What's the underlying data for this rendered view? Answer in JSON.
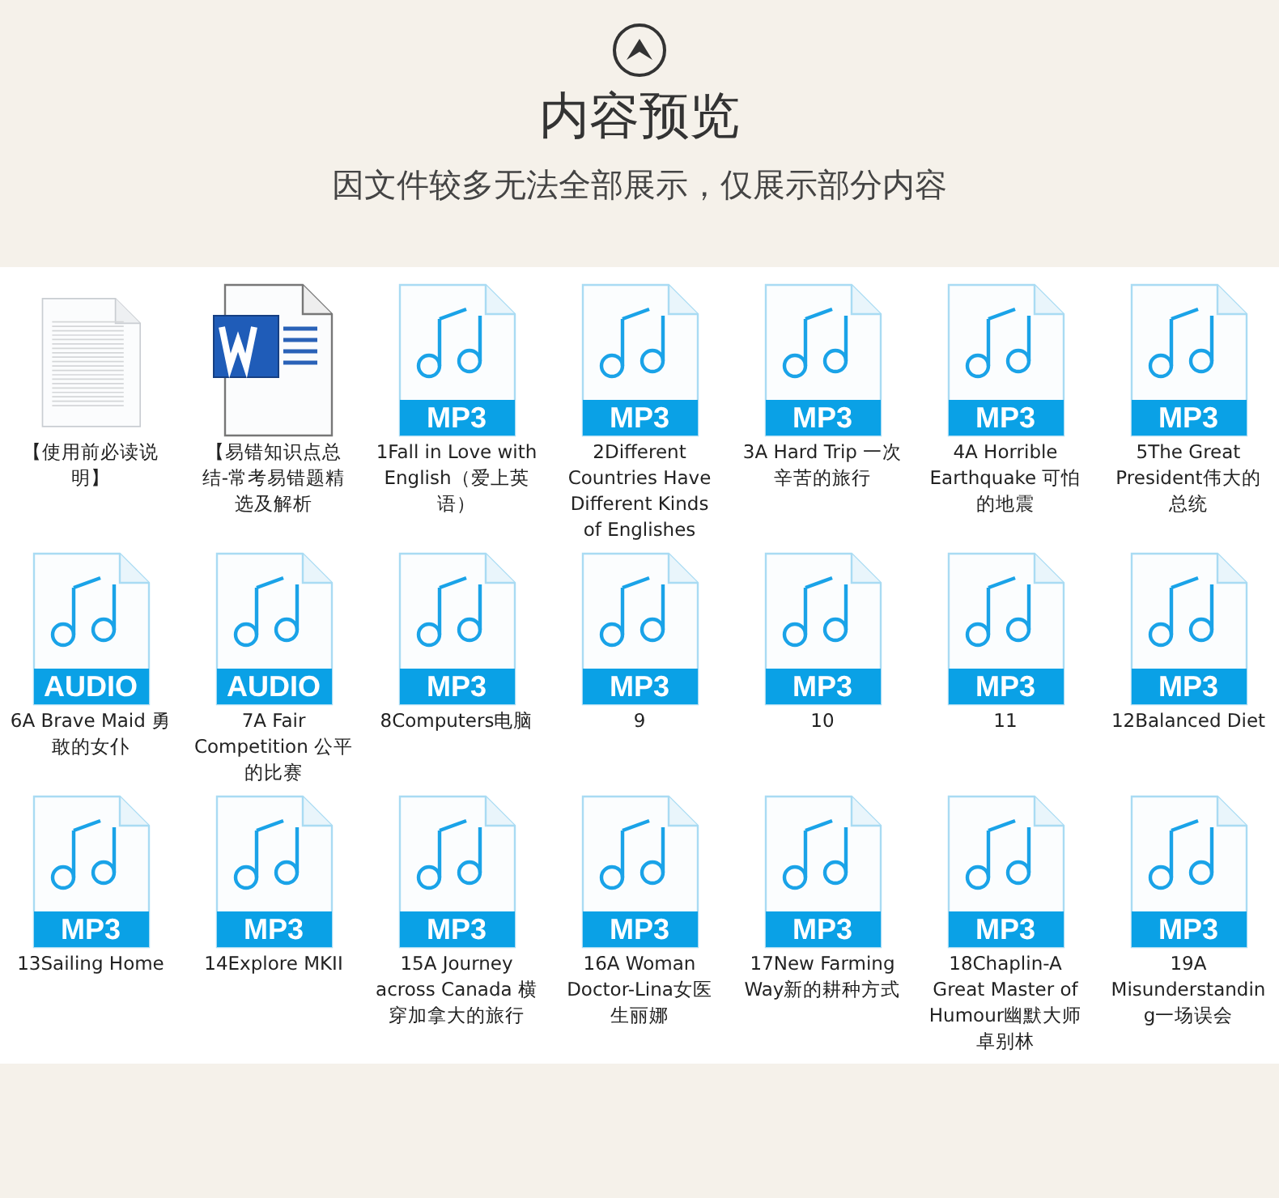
{
  "header": {
    "title": "内容预览",
    "subtitle": "因文件较多无法全部展示，仅展示部分内容"
  },
  "files": [
    {
      "kind": "text",
      "name": "【使用前必读说明】"
    },
    {
      "kind": "word",
      "name": "【易错知识点总结-常考易错题精选及解析"
    },
    {
      "kind": "audio",
      "badge": "MP3",
      "name": "1Fall in Love with English（爱上英语）"
    },
    {
      "kind": "audio",
      "badge": "MP3",
      "name": "2Different Countries Have Different Kinds of Englishes"
    },
    {
      "kind": "audio",
      "badge": "MP3",
      "name": "3A Hard Trip 一次辛苦的旅行"
    },
    {
      "kind": "audio",
      "badge": "MP3",
      "name": "4A Horrible Earthquake 可怕的地震"
    },
    {
      "kind": "audio",
      "badge": "MP3",
      "name": "5The Great President伟大的总统"
    },
    {
      "kind": "audio",
      "badge": "AUDIO",
      "name": "6A Brave Maid 勇敢的女仆"
    },
    {
      "kind": "audio",
      "badge": "AUDIO",
      "name": "7A Fair Competition  公平的比赛"
    },
    {
      "kind": "audio",
      "badge": "MP3",
      "name": "8Computers电脑"
    },
    {
      "kind": "audio",
      "badge": "MP3",
      "name": "9"
    },
    {
      "kind": "audio",
      "badge": "MP3",
      "name": "10"
    },
    {
      "kind": "audio",
      "badge": "MP3",
      "name": "11"
    },
    {
      "kind": "audio",
      "badge": "MP3",
      "name": "12Balanced Diet"
    },
    {
      "kind": "audio",
      "badge": "MP3",
      "name": "13Sailing Home"
    },
    {
      "kind": "audio",
      "badge": "MP3",
      "name": "14Explore MKII"
    },
    {
      "kind": "audio",
      "badge": "MP3",
      "name": "15A Journey across Canada 横穿加拿大的旅行"
    },
    {
      "kind": "audio",
      "badge": "MP3",
      "name": "16A Woman Doctor-Lina女医生丽娜"
    },
    {
      "kind": "audio",
      "badge": "MP3",
      "name": "17New Farming Way新的耕种方式"
    },
    {
      "kind": "audio",
      "badge": "MP3",
      "name": "18Chaplin-A Great Master of Humour幽默大师卓别林"
    },
    {
      "kind": "audio",
      "badge": "MP3",
      "name": "19A Misunderstanding一场误会"
    }
  ]
}
